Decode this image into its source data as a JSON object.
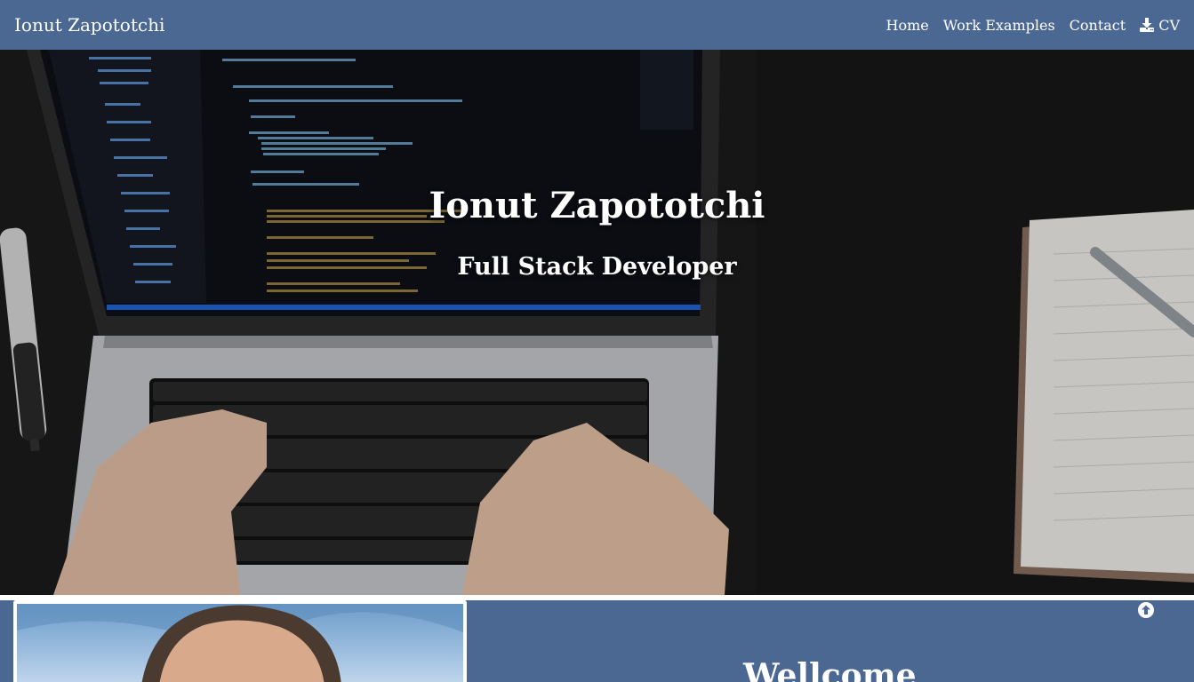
{
  "navbar": {
    "brand": "Ionut Zapototchi",
    "links": [
      {
        "label": "Home"
      },
      {
        "label": "Work Examples"
      },
      {
        "label": "Contact"
      },
      {
        "label": "CV",
        "icon": "download-icon"
      }
    ]
  },
  "hero": {
    "title": "Ionut Zapototchi",
    "subtitle": "Full Stack Developer"
  },
  "about": {
    "heading": "Wellcome",
    "scroll_top_icon": "arrow-up-circle-icon"
  },
  "colors": {
    "navbar_bg": "#4b6893",
    "text": "#ffffff"
  }
}
